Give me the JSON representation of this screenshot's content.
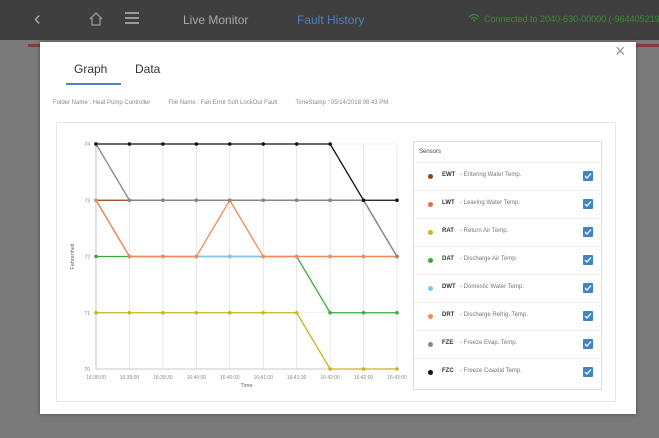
{
  "topbar": {
    "back_icon": "chevron-left-icon",
    "home_icon": "home-icon",
    "menu_icon": "menu-icon",
    "live_label": "Live Monitor",
    "fault_label": "Fault History",
    "wifi_icon": "wifi-icon",
    "connection_text": "Connected to 2040-630-00000 (-9644052193)",
    "accent": "#4f7fc4",
    "connected_color": "#3a8a3a"
  },
  "modal": {
    "close_label": "×",
    "tabs": [
      {
        "label": "Graph",
        "active": true
      },
      {
        "label": "Data",
        "active": false
      }
    ],
    "info": {
      "folder": "Folder Name : Heat Pump Controller",
      "file": "File Name : Fan Error Soft LockOut Fault",
      "time": "TimeStamp : 05/14/2018 08:43 PM"
    }
  },
  "legend": {
    "title": "Sensors",
    "items": [
      {
        "code": "EWT",
        "desc": "- Entering Water Temp.",
        "color": "#8b4513",
        "checked": true
      },
      {
        "code": "LWT",
        "desc": "- Leaving Water Temp.",
        "color": "#e86b4a",
        "checked": true
      },
      {
        "code": "RAT",
        "desc": "- Return Air Temp.",
        "color": "#c9b21c",
        "checked": true
      },
      {
        "code": "DAT",
        "desc": "- Discharge Air Temp.",
        "color": "#3aa93a",
        "checked": true
      },
      {
        "code": "DWT",
        "desc": "- Domestic Water Temp.",
        "color": "#7ec5e8",
        "checked": true
      },
      {
        "code": "DRT",
        "desc": "- Discharge Refrig. Temp.",
        "color": "#f08a5a",
        "checked": true
      },
      {
        "code": "FZE",
        "desc": "- Freeze Evap. Temp.",
        "color": "#888888",
        "checked": true
      },
      {
        "code": "FZC",
        "desc": "- Freeze Coaxial Temp.",
        "color": "#111111",
        "checked": true
      }
    ]
  },
  "chart_data": {
    "type": "line",
    "xlabel": "Time",
    "ylabel": "Fahrenheit",
    "ylim": [
      70,
      74
    ],
    "yticks": [
      70,
      71,
      72,
      73,
      74
    ],
    "x": [
      "16:38:00",
      "16:39:00",
      "16:39:30",
      "16:40:00",
      "16:40:30",
      "16:41:00",
      "16:41:30",
      "16:42:00",
      "16:42:30",
      "16:43:00"
    ],
    "xtick_labels": [
      "16:38:00",
      "16:39:00",
      "16:39:30",
      "16:40:00",
      "16:40:30",
      "16:41:00",
      "16:41:30",
      "16:42:00",
      "16:42:00",
      "16:43:00"
    ],
    "grid": true,
    "series": [
      {
        "name": "EWT",
        "color": "#8b4513",
        "values": [
          73,
          73,
          73,
          73,
          73,
          73,
          73,
          73,
          73,
          72
        ]
      },
      {
        "name": "LWT",
        "color": "#e86b4a",
        "values": [
          73,
          72,
          72,
          72,
          72,
          72,
          72,
          72,
          72,
          72
        ]
      },
      {
        "name": "RAT",
        "color": "#c9b21c",
        "values": [
          71,
          71,
          71,
          71,
          71,
          71,
          71,
          70,
          70,
          70
        ]
      },
      {
        "name": "DAT",
        "color": "#3aa93a",
        "values": [
          72,
          72,
          72,
          72,
          72,
          72,
          72,
          71,
          71,
          71
        ]
      },
      {
        "name": "DWT",
        "color": "#7ec5e8",
        "values": [
          73,
          72,
          72,
          72,
          72,
          72,
          72,
          72,
          72,
          72
        ]
      },
      {
        "name": "DRT",
        "color": "#f08a5a",
        "values": [
          73,
          72,
          72,
          72,
          73,
          72,
          72,
          72,
          72,
          72
        ]
      },
      {
        "name": "FZE",
        "color": "#888888",
        "values": [
          74,
          73,
          73,
          73,
          73,
          73,
          73,
          73,
          73,
          72
        ]
      },
      {
        "name": "FZC",
        "color": "#111111",
        "values": [
          74,
          74,
          74,
          74,
          74,
          74,
          74,
          74,
          73,
          73
        ]
      }
    ]
  }
}
